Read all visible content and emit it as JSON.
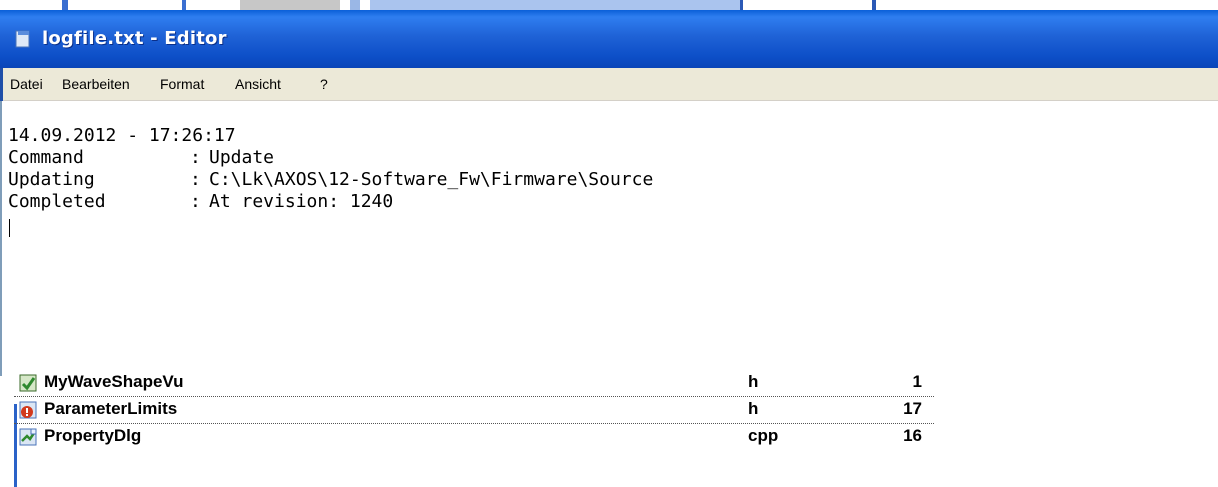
{
  "window": {
    "title": "logfile.txt - Editor"
  },
  "menu": {
    "items": [
      "Datei",
      "Bearbeiten",
      "Format",
      "Ansicht",
      "?"
    ]
  },
  "document": {
    "timestamp_line": "14.09.2012 - 17:26:17",
    "entries": [
      {
        "label": "Command",
        "value": "Update"
      },
      {
        "label": "Updating",
        "value": "C:\\Lk\\AXOS\\12-Software_Fw\\Firmware\\Source"
      },
      {
        "label": "Completed",
        "value": "At revision: 1240"
      }
    ],
    "separator": ":"
  },
  "file_list": {
    "rows": [
      {
        "name": "MyWaveShapeVu",
        "ext": "h",
        "count": "1"
      },
      {
        "name": "ParameterLimits",
        "ext": "h",
        "count": "17"
      },
      {
        "name": "PropertyDlg",
        "ext": "cpp",
        "count": "16"
      }
    ]
  },
  "colors": {
    "titlebar": "#0d4fc8",
    "menubar": "#ece9d8"
  }
}
